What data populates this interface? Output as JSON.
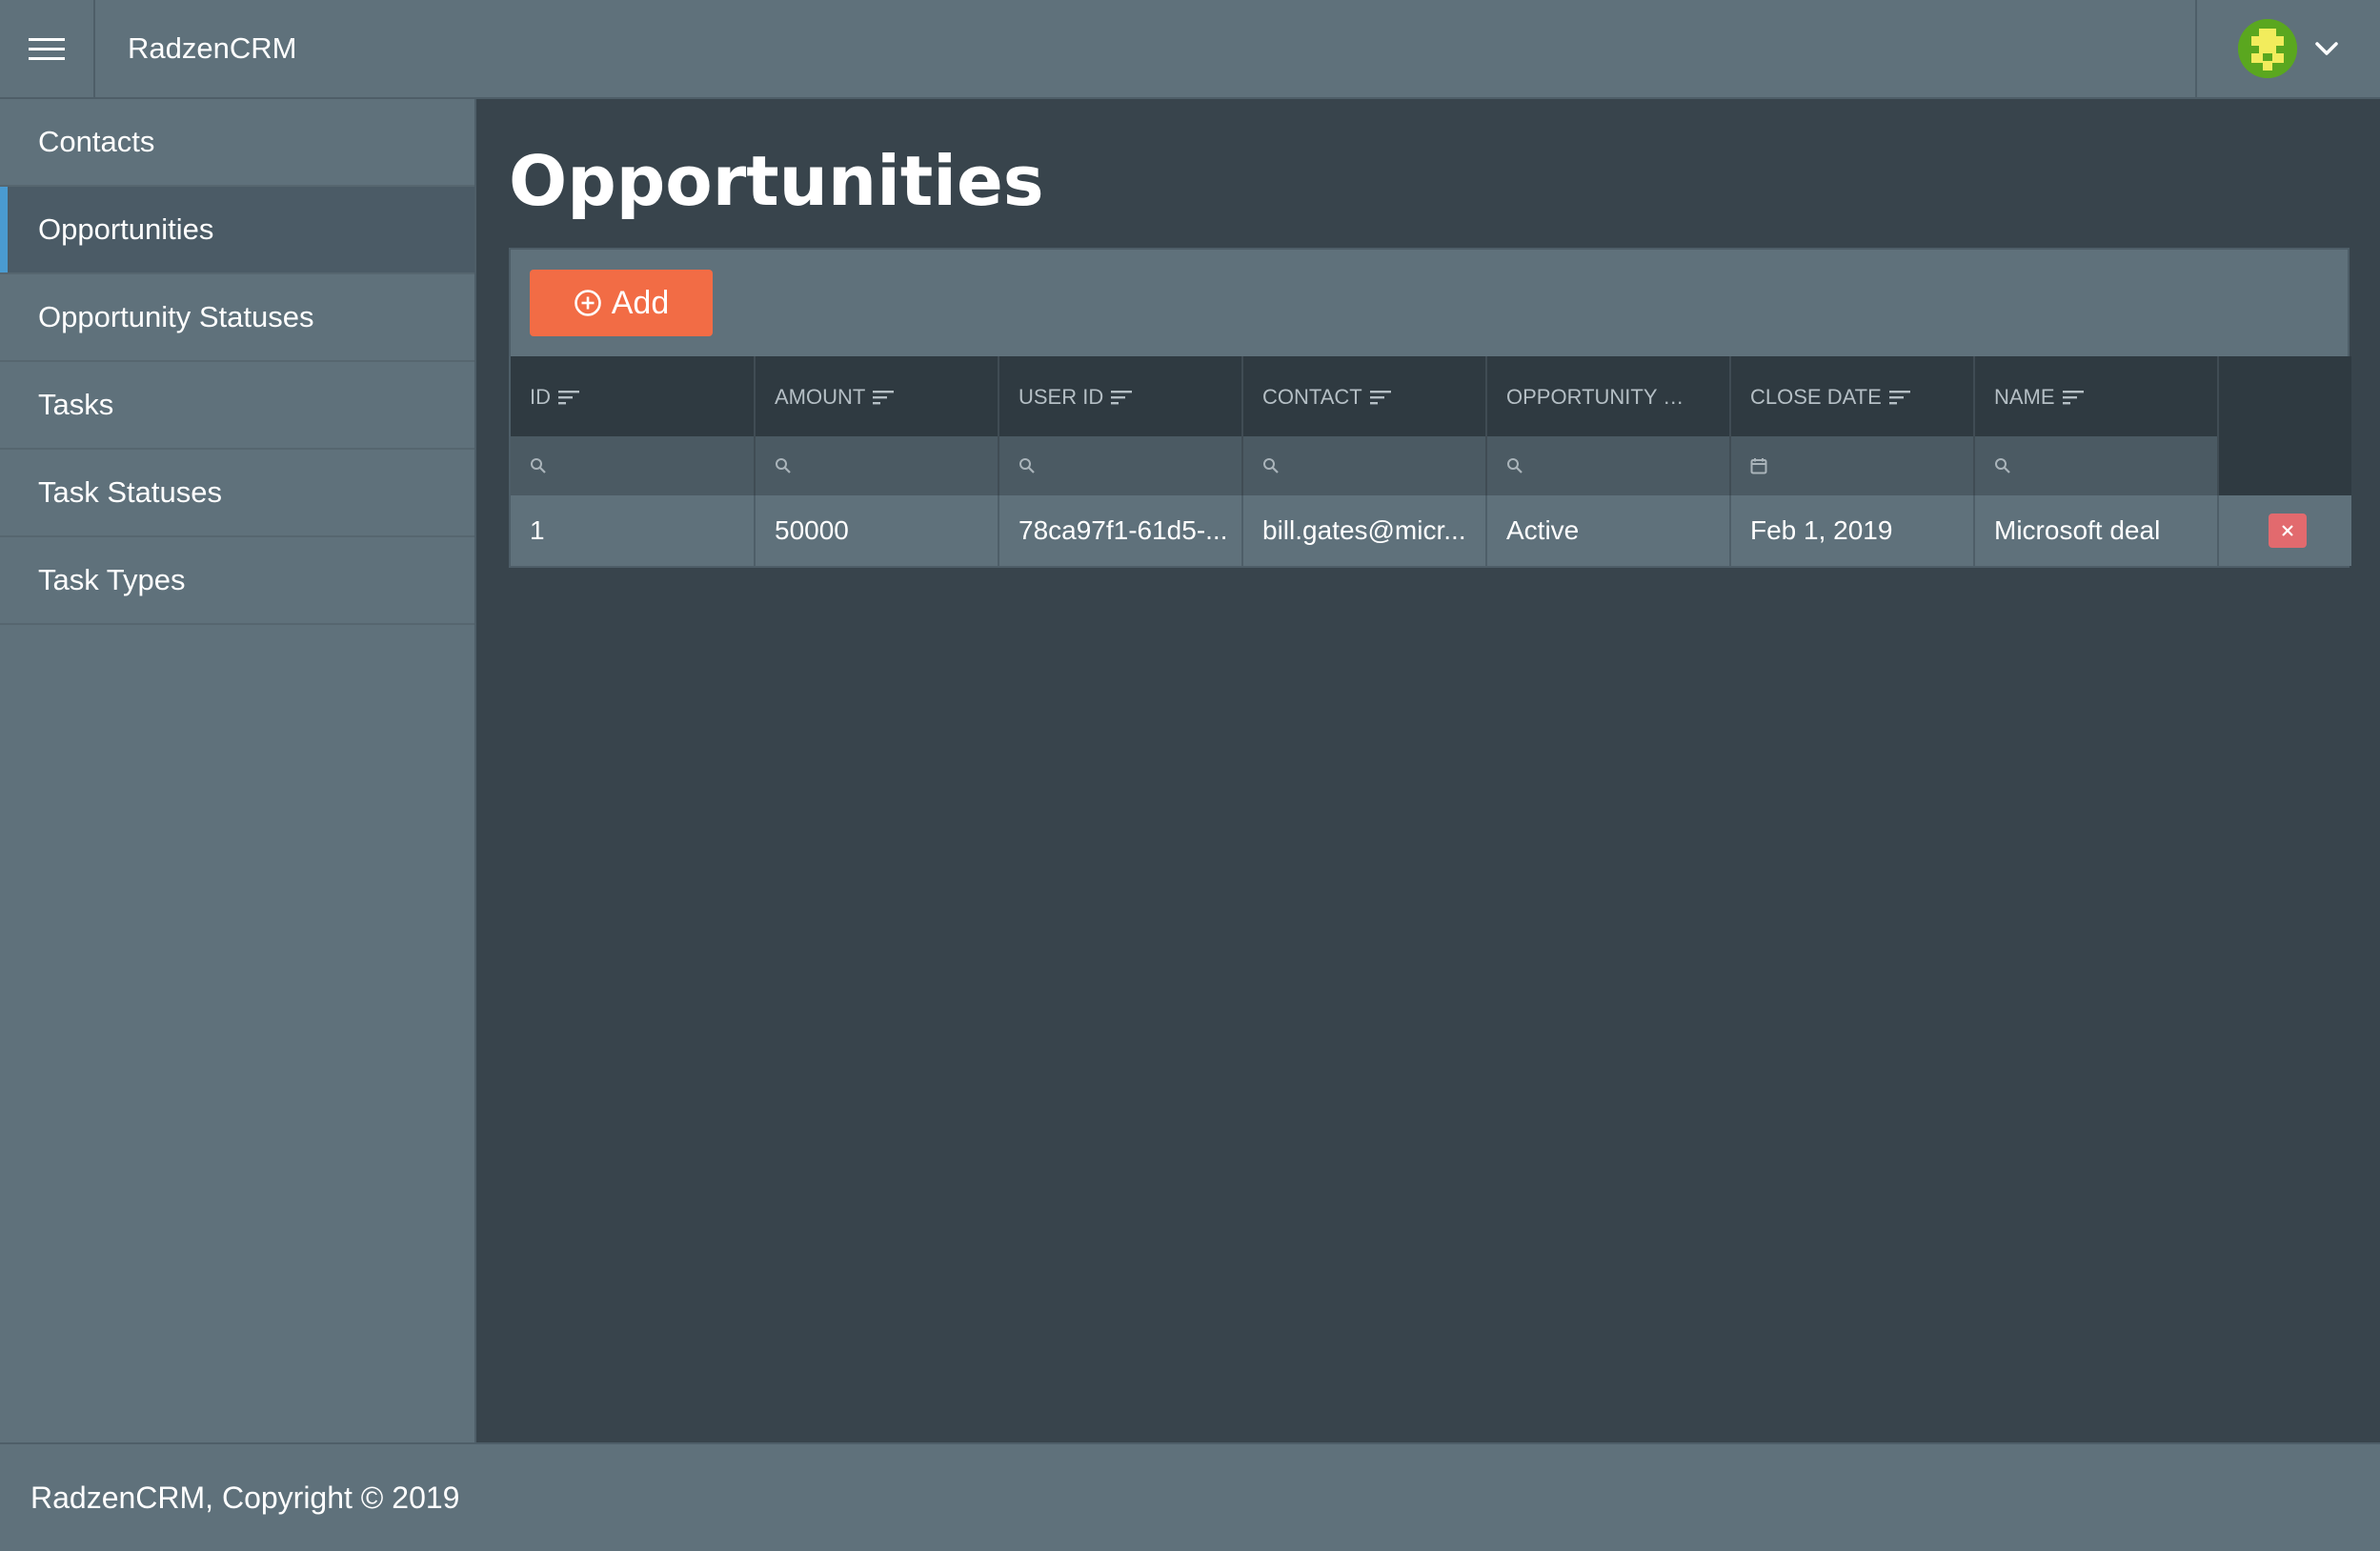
{
  "header": {
    "brand": "RadzenCRM",
    "menu_icon": "hamburger-icon",
    "profile_icon": "avatar",
    "dropdown_icon": "chevron-down-icon"
  },
  "sidebar": {
    "items": [
      {
        "label": "Contacts",
        "active": false
      },
      {
        "label": "Opportunities",
        "active": true
      },
      {
        "label": "Opportunity Statuses",
        "active": false
      },
      {
        "label": "Tasks",
        "active": false
      },
      {
        "label": "Task Statuses",
        "active": false
      },
      {
        "label": "Task Types",
        "active": false
      }
    ]
  },
  "main": {
    "title": "Opportunities",
    "add_label": "Add",
    "columns": [
      {
        "label": "ID",
        "filter": "search-icon"
      },
      {
        "label": "AMOUNT",
        "filter": "search-icon"
      },
      {
        "label": "USER ID",
        "filter": "search-icon"
      },
      {
        "label": "CONTACT",
        "filter": "search-icon"
      },
      {
        "label": "OPPORTUNITY STAT...",
        "filter": "search-icon"
      },
      {
        "label": "CLOSE DATE",
        "filter": "calendar-icon"
      },
      {
        "label": "NAME",
        "filter": "search-icon"
      }
    ],
    "rows": [
      {
        "id": "1",
        "amount": "50000",
        "user_id": "78ca97f1-61d5-...",
        "contact": "bill.gates@micr...",
        "status": "Active",
        "close_date": "Feb 1, 2019",
        "name": "Microsoft deal"
      }
    ]
  },
  "footer": {
    "text": "RadzenCRM, Copyright © 2019"
  },
  "colors": {
    "accent": "#f26c45",
    "active_indicator": "#4a9bd1",
    "delete": "#e26a6e",
    "panel": "#5f717b",
    "background": "#38444c"
  }
}
